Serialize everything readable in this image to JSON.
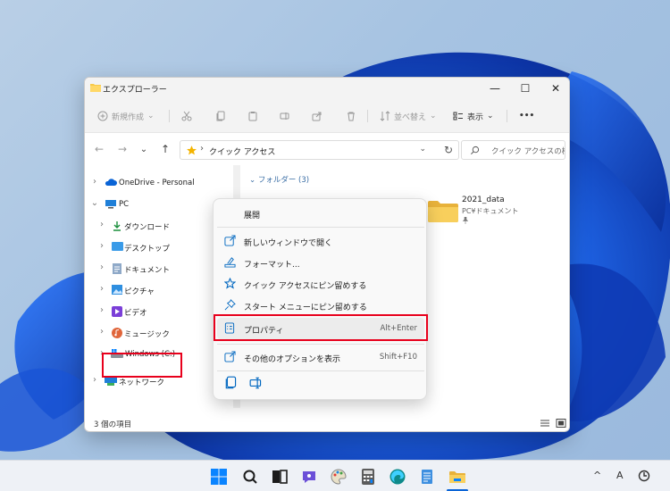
{
  "window": {
    "title": "エクスプローラー",
    "minimize": "—",
    "maximize": "☐",
    "close": "✕"
  },
  "toolbar": {
    "new_label": "新規作成",
    "sort_label": "並べ替え",
    "view_label": "表示",
    "more_label": "•••"
  },
  "address": {
    "path": "クイック アクセス",
    "search_placeholder": "クイック アクセスの検..."
  },
  "sidebar": {
    "items": [
      {
        "label": "OneDrive - Personal",
        "icon": "cloud-icon"
      },
      {
        "label": "PC",
        "icon": "pc-icon"
      },
      {
        "label": "ダウンロード",
        "icon": "download-icon"
      },
      {
        "label": "デスクトップ",
        "icon": "desktop-icon"
      },
      {
        "label": "ドキュメント",
        "icon": "document-icon"
      },
      {
        "label": "ピクチャ",
        "icon": "picture-icon"
      },
      {
        "label": "ビデオ",
        "icon": "video-icon"
      },
      {
        "label": "ミュージック",
        "icon": "music-icon"
      },
      {
        "label": "Windows (C:)",
        "icon": "drive-icon"
      },
      {
        "label": "ネットワーク",
        "icon": "network-icon"
      }
    ]
  },
  "content": {
    "group_header": "フォルダー (3)",
    "folder_name": "2021_data",
    "folder_location": "PC¥ドキュメント"
  },
  "context_menu": {
    "expand": "展開",
    "open_new_window": "新しいウィンドウで開く",
    "format": "フォーマット...",
    "pin_quick_access": "クイック アクセスにピン留めする",
    "pin_start": "スタート メニューにピン留めする",
    "properties": "プロパティ",
    "properties_shortcut": "Alt+Enter",
    "more_options": "その他のオプションを表示",
    "more_options_shortcut": "Shift+F10"
  },
  "status": {
    "item_count": "3 個の項目"
  },
  "tray": {
    "chevron": "^",
    "ime": "A"
  },
  "colors": {
    "accent": "#0067c0",
    "highlight_box": "#e8001c",
    "folder": "#f7c948"
  }
}
